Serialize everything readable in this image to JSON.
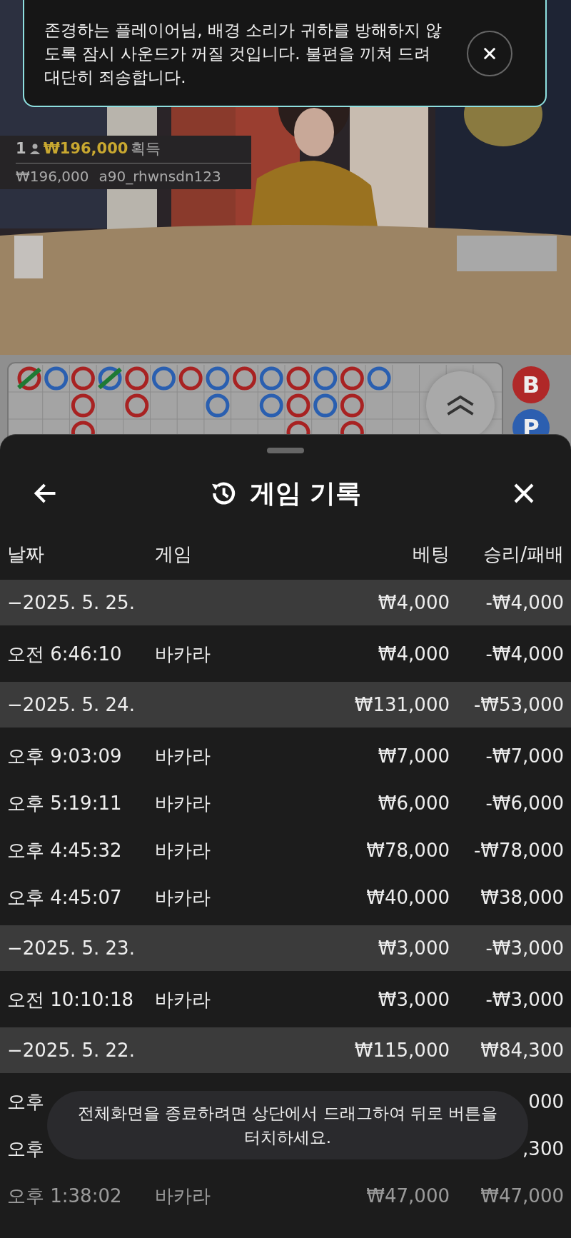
{
  "notification": {
    "message": "존경하는 플레이어님, 배경 소리가 귀하를 방해하지 않도록 잠시 사운드가 꺼질 것입니다. 불편을 끼쳐 드려 대단히 죄송합니다."
  },
  "winner": {
    "count": "1",
    "amount": "₩196,000",
    "label": "획득",
    "detail_amount": "₩196,000",
    "player": "a90_rhwnsdn123"
  },
  "board": {
    "side_bets": [
      {
        "label": "B",
        "color": "#b02828"
      },
      {
        "label": "P",
        "color": "#2c5fb0"
      }
    ]
  },
  "history": {
    "title": "게임 기록",
    "columns": [
      "날짜",
      "게임",
      "베팅",
      "승리/패배"
    ],
    "groups": [
      {
        "date": "−2025. 5. 25.",
        "bet": "₩4,000",
        "result": "-₩4,000",
        "items": [
          {
            "time": "오전 6:46:10",
            "game": "바카라",
            "bet": "₩4,000",
            "result": "-₩4,000",
            "faded": false
          }
        ]
      },
      {
        "date": "−2025. 5. 24.",
        "bet": "₩131,000",
        "result": "-₩53,000",
        "items": [
          {
            "time": "오후 9:03:09",
            "game": "바카라",
            "bet": "₩7,000",
            "result": "-₩7,000",
            "faded": false
          },
          {
            "time": "오후 5:19:11",
            "game": "바카라",
            "bet": "₩6,000",
            "result": "-₩6,000",
            "faded": false
          },
          {
            "time": "오후 4:45:32",
            "game": "바카라",
            "bet": "₩78,000",
            "result": "-₩78,000",
            "faded": false
          },
          {
            "time": "오후 4:45:07",
            "game": "바카라",
            "bet": "₩40,000",
            "result": "₩38,000",
            "faded": false
          }
        ]
      },
      {
        "date": "−2025. 5. 23.",
        "bet": "₩3,000",
        "result": "-₩3,000",
        "items": [
          {
            "time": "오전 10:10:18",
            "game": "바카라",
            "bet": "₩3,000",
            "result": "-₩3,000",
            "faded": false
          }
        ]
      },
      {
        "date": "−2025. 5. 22.",
        "bet": "₩115,000",
        "result": "₩84,300",
        "items": [
          {
            "time": "오후",
            "result": "000",
            "faded": false
          },
          {
            "time": "오후",
            "result": ",300",
            "faded": false
          },
          {
            "time": "오후 1:38:02",
            "game": "바카라",
            "bet": "₩47,000",
            "result": "₩47,000",
            "faded": true
          }
        ]
      }
    ]
  },
  "toast": {
    "message": "전체화면을 종료하려면 상단에서 드래그하여 뒤로 버튼을 터치하세요."
  }
}
